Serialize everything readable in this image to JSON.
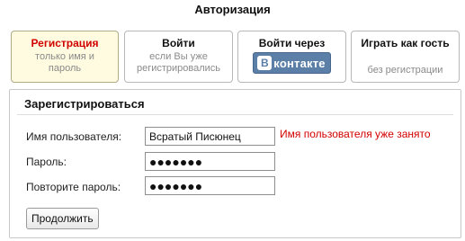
{
  "window": {
    "title": "Авторизация"
  },
  "tabs": [
    {
      "label": "Регистрация",
      "desc_line1": "только имя и",
      "desc_line2": "пароль",
      "active": true
    },
    {
      "label": "Войти",
      "desc_line1": "если Вы уже",
      "desc_line2": "регистрировались",
      "active": false
    },
    {
      "label": "Войти через",
      "logo_text": "контакте",
      "logo_letter": "В",
      "active": false
    },
    {
      "label": "Играть как гость",
      "desc": "без регистрации",
      "active": false
    }
  ],
  "form": {
    "title": "Зарегистрироваться",
    "username_label": "Имя пользователя:",
    "username_value": "Всратый Писюнец",
    "username_error": "Имя пользователя уже занято",
    "password_label": "Пароль:",
    "password_value": "●●●●●●●",
    "confirm_label": "Повторите пароль:",
    "confirm_value": "●●●●●●●",
    "submit_label": "Продолжить"
  },
  "colors": {
    "active_tab_bg": "#fffbe0",
    "active_tab_text": "#d10000",
    "error_text": "#d20000",
    "vk_brand": "#5b7fa6"
  },
  "icons": {
    "vk_logo": "vkontakte-logo-icon"
  }
}
